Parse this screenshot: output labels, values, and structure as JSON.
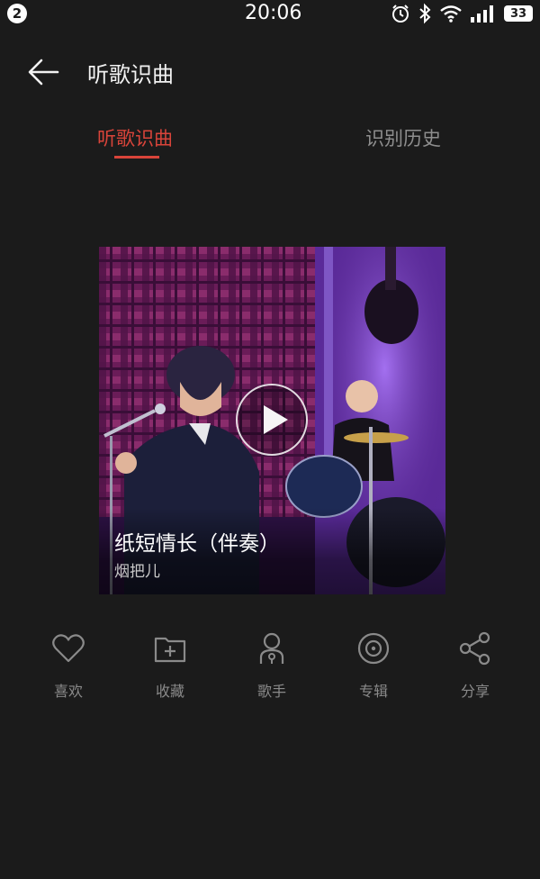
{
  "status_bar": {
    "notification_count": "2",
    "time": "20:06",
    "battery": "33"
  },
  "header": {
    "title": "听歌识曲"
  },
  "tabs": [
    {
      "label": "听歌识曲",
      "active": true
    },
    {
      "label": "识别历史",
      "active": false
    }
  ],
  "result": {
    "song_title": "纸短情长（伴奏）",
    "artist": "烟把儿"
  },
  "actions": [
    {
      "label": "喜欢",
      "icon": "heart-icon"
    },
    {
      "label": "收藏",
      "icon": "folder-add-icon"
    },
    {
      "label": "歌手",
      "icon": "singer-icon"
    },
    {
      "label": "专辑",
      "icon": "album-icon"
    },
    {
      "label": "分享",
      "icon": "share-icon"
    }
  ],
  "colors": {
    "accent": "#d9443a",
    "background": "#1b1b1b",
    "inactive_text": "#8e8e8e"
  }
}
